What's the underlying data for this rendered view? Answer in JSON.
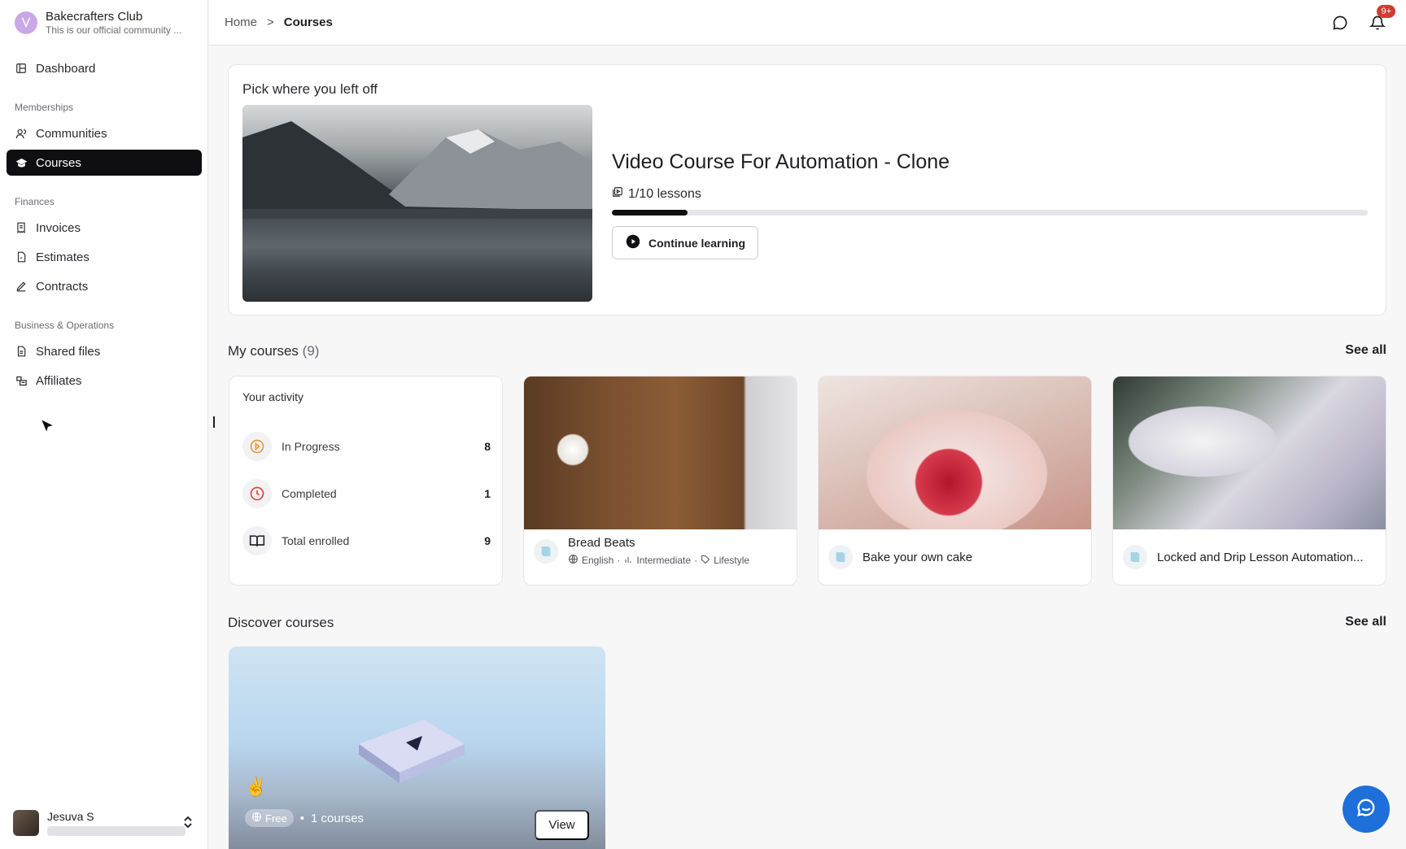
{
  "brand": {
    "name": "Bakecrafters Club",
    "subtitle": "This is our official community ..."
  },
  "sidebar": {
    "dashboard": "Dashboard",
    "sections": [
      {
        "label": "Memberships",
        "items": [
          {
            "label": "Communities",
            "icon": "users-icon"
          },
          {
            "label": "Courses",
            "icon": "graduation-cap-icon",
            "active": true
          }
        ]
      },
      {
        "label": "Finances",
        "items": [
          {
            "label": "Invoices",
            "icon": "receipt-icon"
          },
          {
            "label": "Estimates",
            "icon": "file-icon"
          },
          {
            "label": "Contracts",
            "icon": "pen-icon"
          }
        ]
      },
      {
        "label": "Business & Operations",
        "items": [
          {
            "label": "Shared files",
            "icon": "file-text-icon"
          },
          {
            "label": "Affiliates",
            "icon": "affiliates-icon"
          }
        ]
      }
    ],
    "user": {
      "name": "Jesuva S"
    }
  },
  "topbar": {
    "breadcrumb": [
      "Home",
      ">",
      "Courses"
    ],
    "notifications_badge": "9+"
  },
  "resume": {
    "heading": "Pick where you left off",
    "course_title": "Video Course For Automation - Clone",
    "lessons": "1/10 lessons",
    "progress": 0.1,
    "continue_label": "Continue learning"
  },
  "my_courses": {
    "title": "My courses",
    "count": "(9)",
    "see_all": "See all",
    "activity": {
      "title": "Your activity",
      "rows": [
        {
          "label": "In Progress",
          "value": "8",
          "icon": "play-circle-icon",
          "color": "#e89a3c"
        },
        {
          "label": "Completed",
          "value": "1",
          "icon": "clock-icon",
          "color": "#d34a3f"
        },
        {
          "label": "Total enrolled",
          "value": "9",
          "icon": "book-open-icon",
          "color": "#2a2a30"
        }
      ]
    },
    "courses": [
      {
        "name": "Bread Beats",
        "meta": [
          "English",
          "Intermediate",
          "Lifestyle"
        ]
      },
      {
        "name": "Bake your own cake"
      },
      {
        "name": "Locked and Drip Lesson Automation..."
      }
    ]
  },
  "discover": {
    "title": "Discover courses",
    "see_all": "See all",
    "card": {
      "emoji": "✌️",
      "price": "Free",
      "count": "1 courses",
      "view": "View"
    }
  },
  "colors": {
    "accent": "#0f0f12",
    "fab": "#1e6fd9",
    "badge": "#d23b32"
  }
}
